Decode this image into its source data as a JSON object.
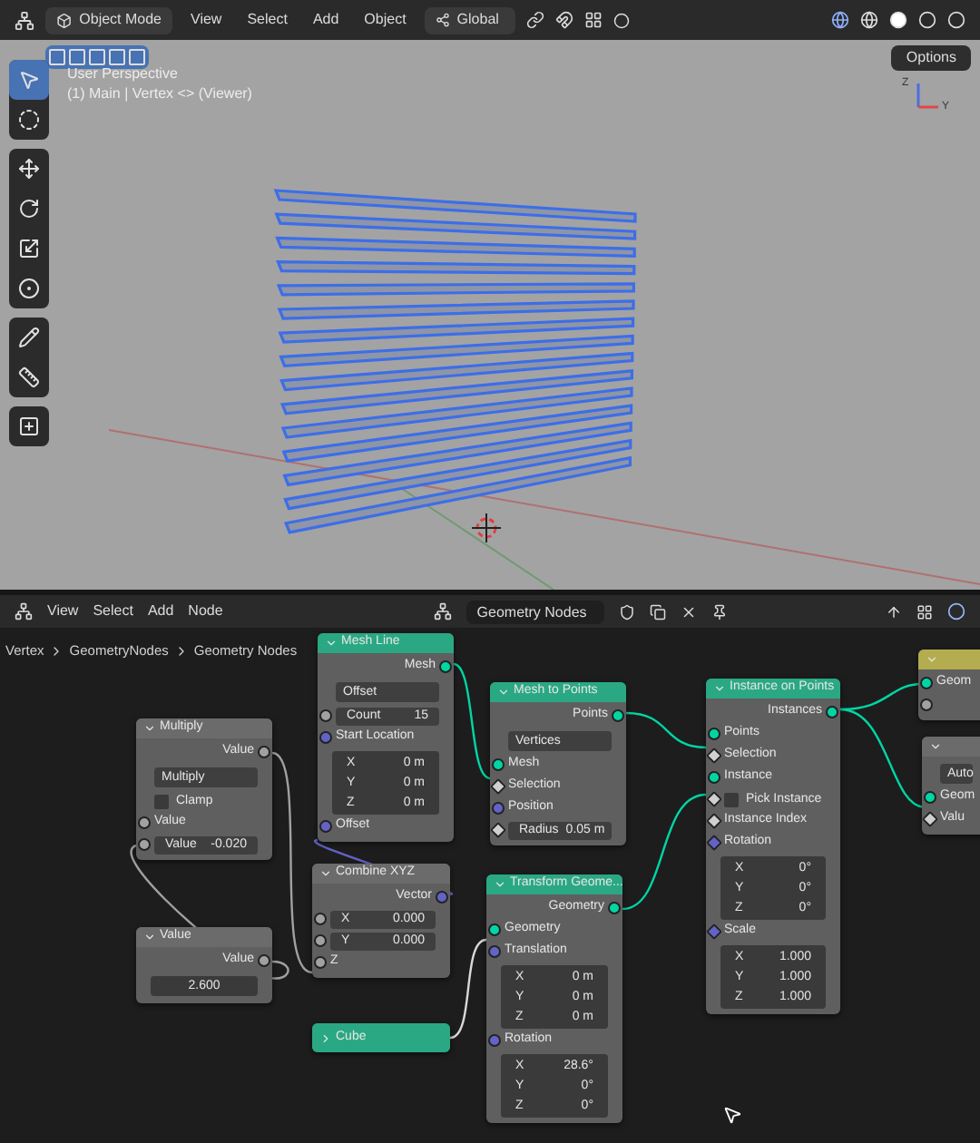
{
  "viewport_header": {
    "mode": "Object Mode",
    "menus": [
      "View",
      "Select",
      "Add",
      "Object"
    ],
    "orientation": "Global"
  },
  "viewport": {
    "options_button": "Options",
    "view_name": "User Perspective",
    "view_info": "(1) Main | Vertex <> (Viewer)",
    "gizmo_labels": [
      "Z",
      "Y"
    ],
    "tools": [
      {
        "selected": true
      },
      {
        "selected": false
      },
      {
        "selected": false
      },
      {
        "selected": false
      },
      {
        "selected": false
      },
      {
        "selected": false
      },
      {
        "selected": false
      },
      {
        "selected": false
      },
      {
        "selected": false
      }
    ]
  },
  "node_editor": {
    "menus": [
      "View",
      "Select",
      "Add",
      "Node"
    ],
    "node_tree": "Geometry Nodes",
    "breadcrumbs": [
      "Vertex",
      "GeometryNodes",
      "Geometry Nodes"
    ],
    "nodes": [
      {
        "title": "Mesh Line",
        "color": "#2aa883",
        "collapsed": false,
        "rows": [
          {
            "kind": "output",
            "label": "Mesh",
            "socket": {
              "kind": "circle",
              "color": "#00d6a3"
            }
          },
          {
            "kind": "dropdown",
            "value": "Offset"
          },
          {
            "kind": "field",
            "label": "Count",
            "value": "15",
            "socket": {
              "kind": "circle",
              "color": "#a1a1a1"
            }
          },
          {
            "kind": "input",
            "label": "Start Location",
            "socket": {
              "kind": "circle",
              "color": "#6363c7"
            }
          },
          {
            "kind": "vector",
            "items": [
              {
                "label": "X",
                "value": "0 m"
              },
              {
                "label": "Y",
                "value": "0 m"
              },
              {
                "label": "Z",
                "value": "0 m"
              }
            ]
          },
          {
            "kind": "input",
            "label": "Offset",
            "socket": {
              "kind": "circle",
              "color": "#6363c7"
            }
          }
        ]
      },
      {
        "title": "Mesh to Points",
        "color": "#2aa883",
        "collapsed": false,
        "rows": [
          {
            "kind": "output",
            "label": "Points",
            "socket": {
              "kind": "circle",
              "color": "#00d6a3"
            }
          },
          {
            "kind": "dropdown",
            "value": "Vertices"
          },
          {
            "kind": "input",
            "label": "Mesh",
            "socket": {
              "kind": "circle",
              "color": "#00d6a3"
            }
          },
          {
            "kind": "input",
            "label": "Selection",
            "socket": {
              "kind": "diamond",
              "color": "#d0d0d0"
            }
          },
          {
            "kind": "input",
            "label": "Position",
            "socket": {
              "kind": "circle",
              "color": "#6363c7"
            }
          },
          {
            "kind": "field",
            "label": "Radius",
            "value": "0.05 m",
            "socket": {
              "kind": "diamond",
              "color": "#d0d0d0"
            }
          }
        ]
      },
      {
        "title": "Instance on Points",
        "color": "#2aa883",
        "collapsed": false,
        "rows": [
          {
            "kind": "output",
            "label": "Instances",
            "socket": {
              "kind": "circle",
              "color": "#00d6a3"
            }
          },
          {
            "kind": "input",
            "label": "Points",
            "socket": {
              "kind": "circle",
              "color": "#00d6a3"
            }
          },
          {
            "kind": "input",
            "label": "Selection",
            "socket": {
              "kind": "diamond",
              "color": "#d0d0d0"
            }
          },
          {
            "kind": "input",
            "label": "Instance",
            "socket": {
              "kind": "circle",
              "color": "#00d6a3"
            }
          },
          {
            "kind": "checkbox",
            "label": "Pick Instance",
            "checked": false,
            "socket": {
              "kind": "diamond",
              "color": "#d0d0d0"
            }
          },
          {
            "kind": "input",
            "label": "Instance Index",
            "socket": {
              "kind": "diamond",
              "color": "#d0d0d0"
            }
          },
          {
            "kind": "input",
            "label": "Rotation",
            "socket": {
              "kind": "diamond",
              "color": "#6363c7"
            }
          },
          {
            "kind": "vector",
            "items": [
              {
                "label": "X",
                "value": "0°"
              },
              {
                "label": "Y",
                "value": "0°"
              },
              {
                "label": "Z",
                "value": "0°"
              }
            ]
          },
          {
            "kind": "input",
            "label": "Scale",
            "socket": {
              "kind": "diamond",
              "color": "#6363c7"
            }
          },
          {
            "kind": "vector",
            "items": [
              {
                "label": "X",
                "value": "1.000"
              },
              {
                "label": "Y",
                "value": "1.000"
              },
              {
                "label": "Z",
                "value": "1.000"
              }
            ]
          }
        ]
      },
      {
        "color": "#b3ad4f",
        "collapsed": false,
        "rows": [
          {
            "kind": "input",
            "label": "Geom",
            "socket": {
              "kind": "circle",
              "color": "#00d6a3"
            }
          },
          {
            "kind": "input",
            "socket": {
              "kind": "circle",
              "color": "#a1a1a1"
            }
          }
        ]
      },
      {
        "color": "#6b6b6b",
        "collapsed": false,
        "rows": [
          {
            "kind": "dropdown",
            "value": "Auto"
          },
          {
            "kind": "input",
            "label": "Geom",
            "socket": {
              "kind": "circle",
              "color": "#00d6a3"
            }
          },
          {
            "kind": "input",
            "label": "Valu",
            "socket": {
              "kind": "diamond",
              "color": "#d0d0d0"
            }
          }
        ]
      },
      {
        "title": "Multiply",
        "color": "#6b6b6b",
        "collapsed": false,
        "rows": [
          {
            "kind": "output",
            "label": "Value",
            "socket": {
              "kind": "circle",
              "color": "#a1a1a1"
            }
          },
          {
            "kind": "dropdown",
            "value": "Multiply"
          },
          {
            "kind": "checkbox",
            "label": "Clamp",
            "checked": false
          },
          {
            "kind": "input",
            "label": "Value",
            "socket": {
              "kind": "circle",
              "color": "#a1a1a1"
            }
          },
          {
            "kind": "field",
            "label": "Value",
            "value": "-0.020",
            "socket": {
              "kind": "circle",
              "color": "#a1a1a1"
            }
          }
        ]
      },
      {
        "title": "Combine XYZ",
        "color": "#6b6b6b",
        "collapsed": false,
        "rows": [
          {
            "kind": "output",
            "label": "Vector",
            "socket": {
              "kind": "circle",
              "color": "#6363c7"
            }
          },
          {
            "kind": "field",
            "label": "X",
            "value": "0.000",
            "socket": {
              "kind": "circle",
              "color": "#a1a1a1"
            }
          },
          {
            "kind": "field",
            "label": "Y",
            "value": "0.000",
            "socket": {
              "kind": "circle",
              "color": "#a1a1a1"
            }
          },
          {
            "kind": "input",
            "label": "Z",
            "socket": {
              "kind": "circle",
              "color": "#a1a1a1"
            }
          }
        ]
      },
      {
        "title": "Value",
        "color": "#6b6b6b",
        "collapsed": false,
        "rows": [
          {
            "kind": "output",
            "label": "Value",
            "socket": {
              "kind": "circle",
              "color": "#a1a1a1"
            }
          },
          {
            "kind": "value",
            "value": "2.600"
          }
        ]
      },
      {
        "title": "Cube",
        "color": "#2aa883",
        "collapsed": true
      },
      {
        "title": "Transform Geome...",
        "color": "#2aa883",
        "collapsed": false,
        "rows": [
          {
            "kind": "output",
            "label": "Geometry",
            "socket": {
              "kind": "circle",
              "color": "#00d6a3"
            }
          },
          {
            "kind": "input",
            "label": "Geometry",
            "socket": {
              "kind": "circle",
              "color": "#00d6a3"
            }
          },
          {
            "kind": "input",
            "label": "Translation",
            "socket": {
              "kind": "circle",
              "color": "#6363c7"
            }
          },
          {
            "kind": "vector",
            "items": [
              {
                "label": "X",
                "value": "0 m"
              },
              {
                "label": "Y",
                "value": "0 m"
              },
              {
                "label": "Z",
                "value": "0 m"
              }
            ]
          },
          {
            "kind": "input",
            "label": "Rotation",
            "socket": {
              "kind": "circle",
              "color": "#6363c7"
            }
          },
          {
            "kind": "vector",
            "items": [
              {
                "label": "X",
                "value": "28.6°"
              },
              {
                "label": "Y",
                "value": "0°"
              },
              {
                "label": "Z",
                "value": "0°"
              }
            ]
          }
        ]
      }
    ]
  }
}
